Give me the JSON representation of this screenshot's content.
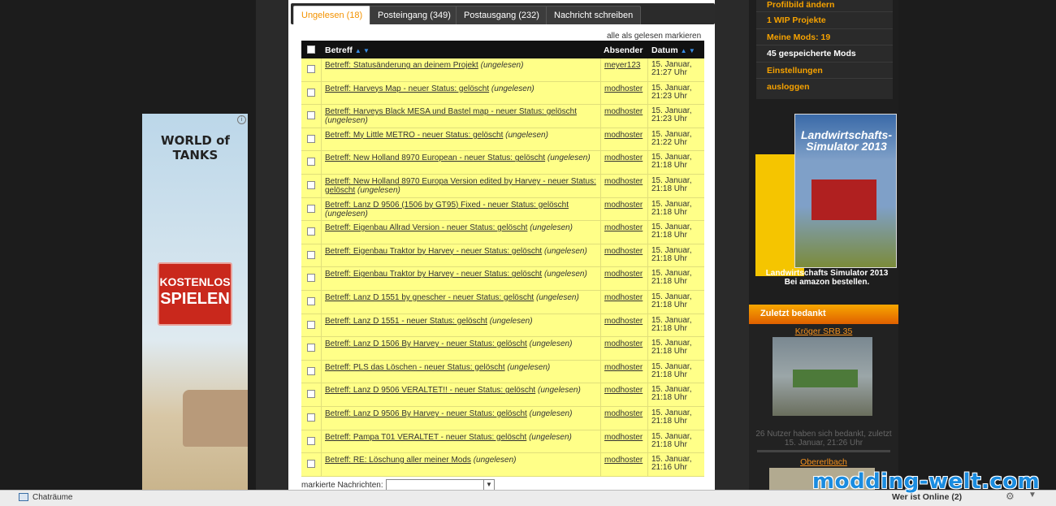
{
  "tabs": [
    {
      "label": "Ungelesen (18)",
      "active": true
    },
    {
      "label": "Posteingang (349)",
      "active": false
    },
    {
      "label": "Postausgang (232)",
      "active": false
    },
    {
      "label": "Nachricht schreiben",
      "active": false
    }
  ],
  "mark_all_read": "alle als gelesen markieren",
  "columns": {
    "subject": "Betreff",
    "sender": "Absender",
    "date": "Datum"
  },
  "messages": [
    {
      "subject": "Betreff: Statusänderung an deinem Projekt",
      "status": "(ungelesen)",
      "sender": "meyer123",
      "date": "15. Januar, 21:27 Uhr"
    },
    {
      "subject": "Betreff: Harveys Map - neuer Status: gelöscht",
      "status": "(ungelesen)",
      "sender": "modhoster",
      "date": "15. Januar, 21:23 Uhr"
    },
    {
      "subject": "Betreff: Harveys Black MESA und Bastel map - neuer Status: gelöscht",
      "status": "(ungelesen)",
      "sender": "modhoster",
      "date": "15. Januar, 21:23 Uhr"
    },
    {
      "subject": "Betreff: My Little METRO - neuer Status: gelöscht",
      "status": "(ungelesen)",
      "sender": "modhoster",
      "date": "15. Januar, 21:22 Uhr"
    },
    {
      "subject": "Betreff: New Holland 8970 European - neuer Status: gelöscht",
      "status": "(ungelesen)",
      "sender": "modhoster",
      "date": "15. Januar, 21:18 Uhr"
    },
    {
      "subject": "Betreff: New Holland 8970 Europa Version edited by Harvey - neuer Status: gelöscht",
      "status": "(ungelesen)",
      "sender": "modhoster",
      "date": "15. Januar, 21:18 Uhr"
    },
    {
      "subject": "Betreff: Lanz D 9506 (1506 by GT95) Fixed - neuer Status: gelöscht",
      "status": "(ungelesen)",
      "sender": "modhoster",
      "date": "15. Januar, 21:18 Uhr"
    },
    {
      "subject": "Betreff: Eigenbau Allrad Version - neuer Status: gelöscht",
      "status": "(ungelesen)",
      "sender": "modhoster",
      "date": "15. Januar, 21:18 Uhr"
    },
    {
      "subject": "Betreff: Eigenbau Traktor by Harvey - neuer Status: gelöscht",
      "status": "(ungelesen)",
      "sender": "modhoster",
      "date": "15. Januar, 21:18 Uhr"
    },
    {
      "subject": "Betreff: Eigenbau Traktor by Harvey - neuer Status: gelöscht",
      "status": "(ungelesen)",
      "sender": "modhoster",
      "date": "15. Januar, 21:18 Uhr"
    },
    {
      "subject": "Betreff: Lanz D 1551 by gnescher - neuer Status: gelöscht",
      "status": "(ungelesen)",
      "sender": "modhoster",
      "date": "15. Januar, 21:18 Uhr"
    },
    {
      "subject": "Betreff: Lanz D 1551 - neuer Status: gelöscht",
      "status": "(ungelesen)",
      "sender": "modhoster",
      "date": "15. Januar, 21:18 Uhr"
    },
    {
      "subject": "Betreff: Lanz D 1506 By Harvey - neuer Status: gelöscht",
      "status": "(ungelesen)",
      "sender": "modhoster",
      "date": "15. Januar, 21:18 Uhr"
    },
    {
      "subject": "Betreff: PLS das Löschen - neuer Status: gelöscht",
      "status": "(ungelesen)",
      "sender": "modhoster",
      "date": "15. Januar, 21:18 Uhr"
    },
    {
      "subject": "Betreff: Lanz D 9506 VERALTET!! - neuer Status: gelöscht",
      "status": "(ungelesen)",
      "sender": "modhoster",
      "date": "15. Januar, 21:18 Uhr"
    },
    {
      "subject": "Betreff: Lanz D 9506 By Harvey - neuer Status: gelöscht",
      "status": "(ungelesen)",
      "sender": "modhoster",
      "date": "15. Januar, 21:18 Uhr"
    },
    {
      "subject": "Betreff: Pampa T01 VERALTET - neuer Status: gelöscht",
      "status": "(ungelesen)",
      "sender": "modhoster",
      "date": "15. Januar, 21:18 Uhr"
    },
    {
      "subject": "Betreff: RE: Löschung aller meiner Mods",
      "status": "(ungelesen)",
      "sender": "modhoster",
      "date": "15. Januar, 21:16 Uhr"
    }
  ],
  "marked_label": "markierte Nachrichten:",
  "right_menu": [
    {
      "label": "Profilbild ändern",
      "white": false
    },
    {
      "label": "1 WIP Projekte",
      "white": false
    },
    {
      "label": "Meine Mods: 19",
      "white": false
    },
    {
      "label": "45 gespeicherte Mods",
      "white": true
    },
    {
      "label": "Einstellungen",
      "white": false
    },
    {
      "label": "ausloggen",
      "white": false
    }
  ],
  "ad": {
    "game": "WORLD of TANKS",
    "line1": "KOSTENLOS",
    "line2": "SPIELEN"
  },
  "product": {
    "box_title": "Landwirtschafts-Simulator 2013",
    "caption1": "Landwirtschafts Simulator 2013",
    "caption2": "Bei amazon bestellen."
  },
  "thanked": {
    "header": "Zuletzt bedankt",
    "item1": "Kröger SRB 35",
    "info1": "26 Nutzer haben sich bedankt, zuletzt",
    "info2": "15. Januar, 21:26 Uhr",
    "item2": "Obererlbach"
  },
  "bottom": {
    "chat": "Chaträume",
    "online": "Wer ist Online (2)"
  },
  "watermark": "modding-welt.com"
}
